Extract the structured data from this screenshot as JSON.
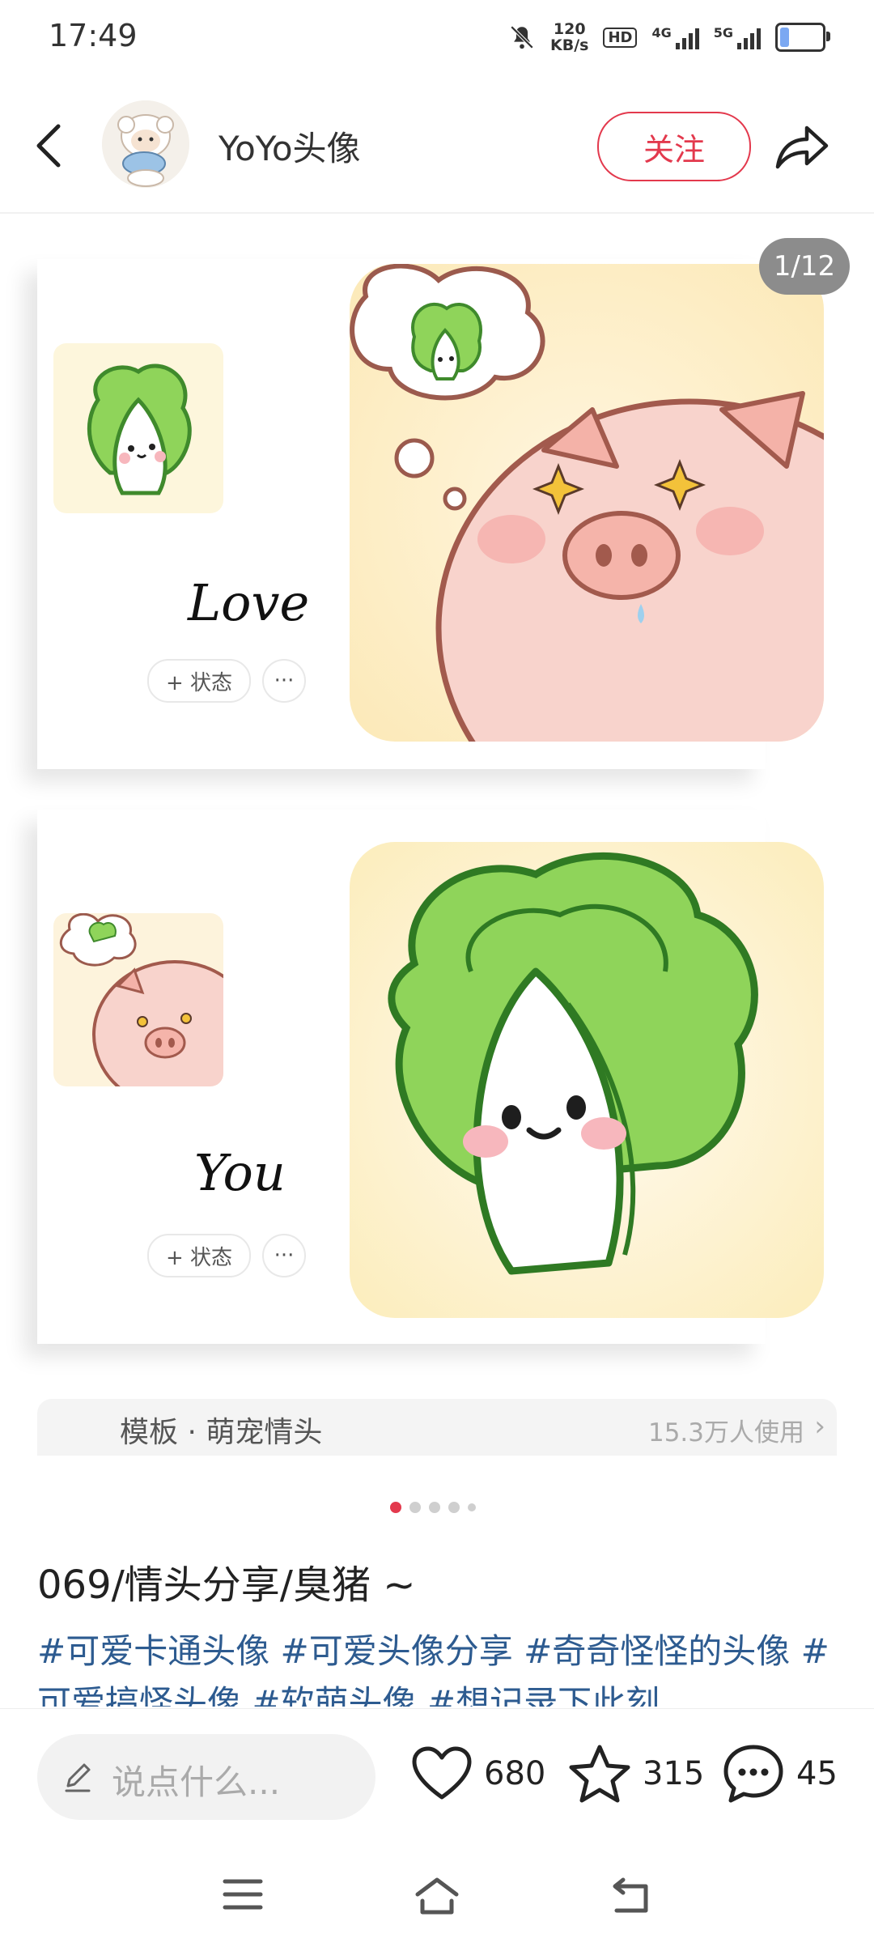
{
  "status_bar": {
    "time": "17:49",
    "speed_value": "120",
    "speed_unit": "KB/s",
    "hd_badge": "HD",
    "net_4g": "4G",
    "net_5g": "5G"
  },
  "header": {
    "author_name": "YoYo头像",
    "follow_label": "关注"
  },
  "carousel": {
    "counter": "1/12",
    "card1": {
      "caption": "Love",
      "status_label": "+ 状态",
      "more_label": "···"
    },
    "card2": {
      "caption": "You",
      "status_label": "+ 状态",
      "more_label": "···"
    },
    "template_name": "模板 · 萌宠情头",
    "template_users": "15.3万人使用",
    "page_count": 5,
    "active_page": 1
  },
  "post": {
    "title": "069/情头分享/臭猪 ~",
    "tags": "#可爱卡通头像 #可爱头像分享 #奇奇怪怪的头像 #可爱搞怪头像 #软萌头像 #想记录下此刻"
  },
  "actions": {
    "comment_placeholder": "说点什么...",
    "likes": "680",
    "stars": "315",
    "comments": "45"
  },
  "colors": {
    "accent": "#e3394d",
    "tag_blue": "#2d5b90",
    "cabbage_green": "#7ac74f",
    "pig_pink": "#f4c4bd"
  },
  "icons": [
    "back-arrow-icon",
    "share-icon",
    "pencil-icon",
    "heart-icon",
    "star-icon",
    "chat-bubble-icon",
    "menu-icon",
    "home-icon",
    "return-icon"
  ]
}
